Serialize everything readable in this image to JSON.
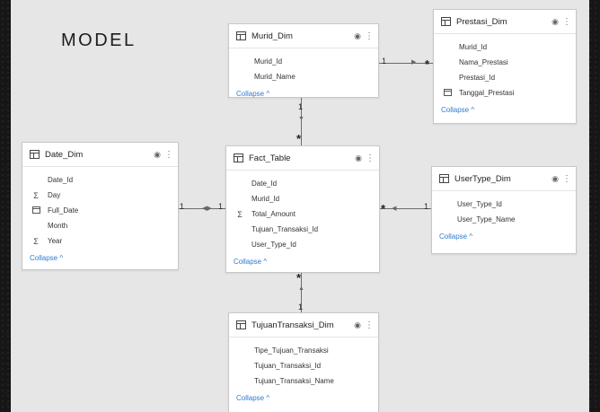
{
  "title": "MODEL",
  "tables": {
    "murid": {
      "name": "Murid_Dim",
      "fields": [
        "Murid_Id",
        "Murid_Name"
      ],
      "collapse": "Collapse ^"
    },
    "prestasi": {
      "name": "Prestasi_Dim",
      "fields": [
        "Murid_Id",
        "Nama_Prestasi",
        "Prestasi_Id",
        "Tanggal_Prestasi"
      ],
      "collapse": "Collapse ^"
    },
    "date": {
      "name": "Date_Dim",
      "fields": [
        "Date_Id",
        "Day",
        "Full_Date",
        "Month",
        "Year"
      ],
      "collapse": "Collapse ^"
    },
    "fact": {
      "name": "Fact_Table",
      "fields": [
        "Date_Id",
        "Murid_Id",
        "Total_Amount",
        "Tujuan_Transaksi_Id",
        "User_Type_Id"
      ],
      "collapse": "Collapse ^"
    },
    "usertype": {
      "name": "UserType_Dim",
      "fields": [
        "User_Type_Id",
        "User_Type_Name"
      ],
      "collapse": "Collapse ^"
    },
    "tujuan": {
      "name": "TujuanTransaksi_Dim",
      "fields": [
        "Tipe_Tujuan_Transaksi",
        "Tujuan_Transaksi_Id",
        "Tujuan_Transaksi_Name"
      ],
      "collapse": "Collapse ^"
    }
  },
  "relationships": {
    "one": "1",
    "many": "*"
  },
  "icons": {
    "table": "table-icon",
    "visibility": "eye-icon",
    "more": "more-options-icon",
    "sum": "sigma-icon",
    "calendar": "calendar-icon"
  }
}
